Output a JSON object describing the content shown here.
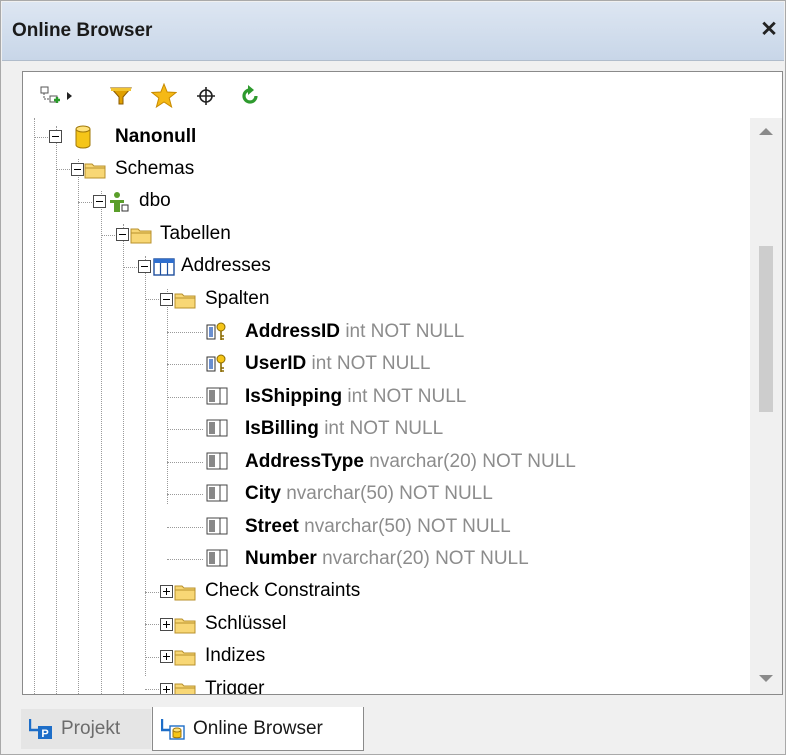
{
  "window": {
    "title": "Online Browser",
    "close_label": "✕"
  },
  "toolbar": {
    "buttons": [
      {
        "icon": "add-datasource-icon"
      },
      {
        "icon": "dropdown-arrow-icon"
      },
      {
        "icon": "filter-icon"
      },
      {
        "icon": "favorites-star-icon"
      },
      {
        "icon": "locate-object-icon"
      },
      {
        "icon": "refresh-icon"
      }
    ]
  },
  "tree": {
    "nodes": [
      {
        "label": "Nanonull",
        "icon": "database-icon",
        "expanded": true,
        "bold": true
      },
      {
        "label": "Schemas",
        "icon": "folder-icon",
        "expanded": true
      },
      {
        "label": "dbo",
        "icon": "schema-user-icon",
        "expanded": true
      },
      {
        "label": "Tabellen",
        "icon": "folder-icon",
        "expanded": true
      },
      {
        "label": "Addresses",
        "icon": "table-icon",
        "expanded": true
      },
      {
        "label": "Spalten",
        "icon": "folder-icon",
        "expanded": true
      }
    ],
    "columns": [
      {
        "name": "AddressID",
        "type": "int NOT NULL",
        "icon": "primary-key-column-icon"
      },
      {
        "name": "UserID",
        "type": "int NOT NULL",
        "icon": "primary-key-column-icon"
      },
      {
        "name": "IsShipping",
        "type": "int NOT NULL",
        "icon": "column-icon"
      },
      {
        "name": "IsBilling",
        "type": "int NOT NULL",
        "icon": "column-icon"
      },
      {
        "name": "AddressType",
        "type": "nvarchar(20) NOT NULL",
        "icon": "column-icon"
      },
      {
        "name": "City",
        "type": "nvarchar(50) NOT NULL",
        "icon": "column-icon"
      },
      {
        "name": "Street",
        "type": "nvarchar(50) NOT NULL",
        "icon": "column-icon"
      },
      {
        "name": "Number",
        "type": "nvarchar(20) NOT NULL",
        "icon": "column-icon"
      }
    ],
    "collapsed_folders": [
      {
        "label": "Check Constraints",
        "icon": "folder-icon",
        "expanded": false
      },
      {
        "label": "Schlüssel",
        "icon": "folder-icon",
        "expanded": false
      },
      {
        "label": "Indizes",
        "icon": "folder-icon",
        "expanded": false
      },
      {
        "label": "Trigger",
        "icon": "folder-icon",
        "expanded": false
      }
    ]
  },
  "tabs": [
    {
      "label": "Projekt",
      "icon": "project-icon",
      "active": false
    },
    {
      "label": "Online Browser",
      "icon": "online-browser-icon",
      "active": true
    }
  ],
  "colors": {
    "titlebar": "#c8d6e8",
    "folder": "#f8d775",
    "database": "#f5c518",
    "column_type": "#8c8c8c",
    "refresh": "#2e9a2e",
    "filter": "#e0a000"
  }
}
